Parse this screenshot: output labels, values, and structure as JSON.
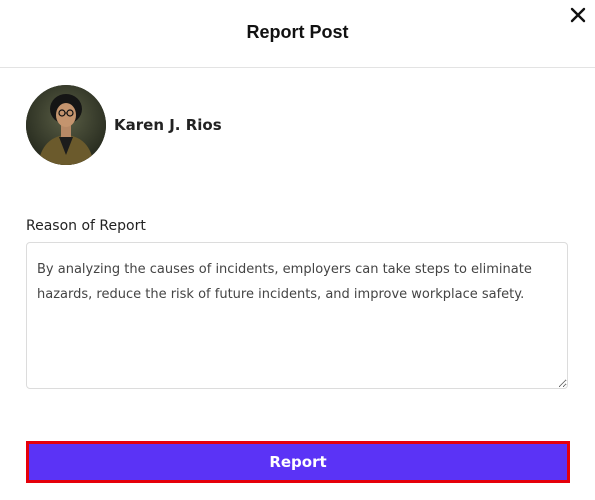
{
  "dialog": {
    "title": "Report Post",
    "close_icon": "close-icon"
  },
  "user": {
    "name": "Karen J. Rios",
    "avatar_icon": "avatar"
  },
  "form": {
    "reason_label": "Reason of Report",
    "reason_value": "By analyzing the causes of incidents, employers can take steps to eliminate hazards, reduce the risk of future incidents, and improve workplace safety."
  },
  "actions": {
    "report_label": "Report"
  },
  "colors": {
    "accent": "#5b33f6",
    "highlight_border": "#e5000b"
  }
}
